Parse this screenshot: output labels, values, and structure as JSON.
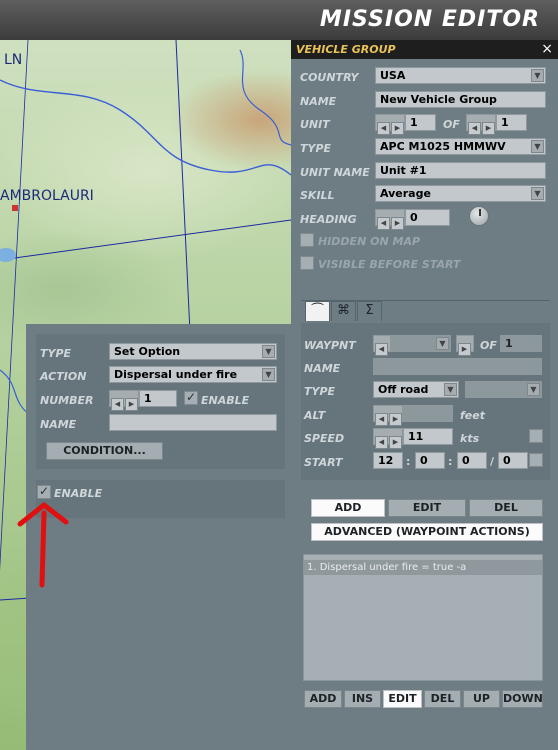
{
  "app": {
    "title": "MISSION EDITOR"
  },
  "map": {
    "labels": [
      "LN",
      "AMBROLAURI"
    ]
  },
  "vehicle_group": {
    "header": "VEHICLE GROUP",
    "close": "×",
    "country": {
      "label": "COUNTRY",
      "value": "USA"
    },
    "name": {
      "label": "NAME",
      "value": "New Vehicle Group"
    },
    "unit": {
      "label": "UNIT",
      "value": "1",
      "of_label": "OF",
      "of_value": "1"
    },
    "type": {
      "label": "TYPE",
      "value": "APC M1025 HMMWV"
    },
    "unit_name": {
      "label": "UNIT NAME",
      "value": "Unit #1"
    },
    "skill": {
      "label": "SKILL",
      "value": "Average"
    },
    "heading": {
      "label": "HEADING",
      "value": "0"
    },
    "hidden_on_map": {
      "label": "HIDDEN ON MAP",
      "checked": false
    },
    "visible_before_start": {
      "label": "VISIBLE BEFORE START",
      "checked": false
    },
    "tabs": [
      {
        "icon": "route-icon",
        "glyph": "⏜",
        "active": true
      },
      {
        "icon": "triggers-icon",
        "glyph": "⌘",
        "active": false
      },
      {
        "icon": "summary-icon",
        "glyph": "Σ",
        "active": false
      }
    ]
  },
  "waypoint": {
    "waypnt_label": "WAYPNT",
    "of_label": "OF",
    "of_value": "1",
    "name_label": "NAME",
    "type_label": "TYPE",
    "type_value": "Off road",
    "alt_label": "ALT",
    "alt_unit": "feet",
    "speed_label": "SPEED",
    "speed_value": "11",
    "speed_unit": "kts",
    "start_label": "START",
    "start_h": "12",
    "start_m": "0",
    "start_s": "0",
    "start_d": "0",
    "sep_colon": ":",
    "sep_slash": "/",
    "add": "ADD",
    "edit": "EDIT",
    "del": "DEL",
    "advanced": "ADVANCED (WAYPOINT ACTIONS)"
  },
  "actions_list": {
    "items": [
      "1. Dispersal under fire = true -a"
    ],
    "buttons": [
      "ADD",
      "INS",
      "EDIT",
      "DEL",
      "UP",
      "DOWN"
    ]
  },
  "action_editor": {
    "type_label": "TYPE",
    "type_value": "Set Option",
    "action_label": "ACTION",
    "action_value": "Dispersal under fire",
    "number_label": "NUMBER",
    "number_value": "1",
    "enable_label": "ENABLE",
    "number_enable_checked": true,
    "name_label": "NAME",
    "name_value": "",
    "condition_button": "CONDITION...",
    "enable_checked": true,
    "enable_checkbox_label": "ENABLE"
  },
  "annotation": {
    "arrow_color": "#e01010"
  }
}
